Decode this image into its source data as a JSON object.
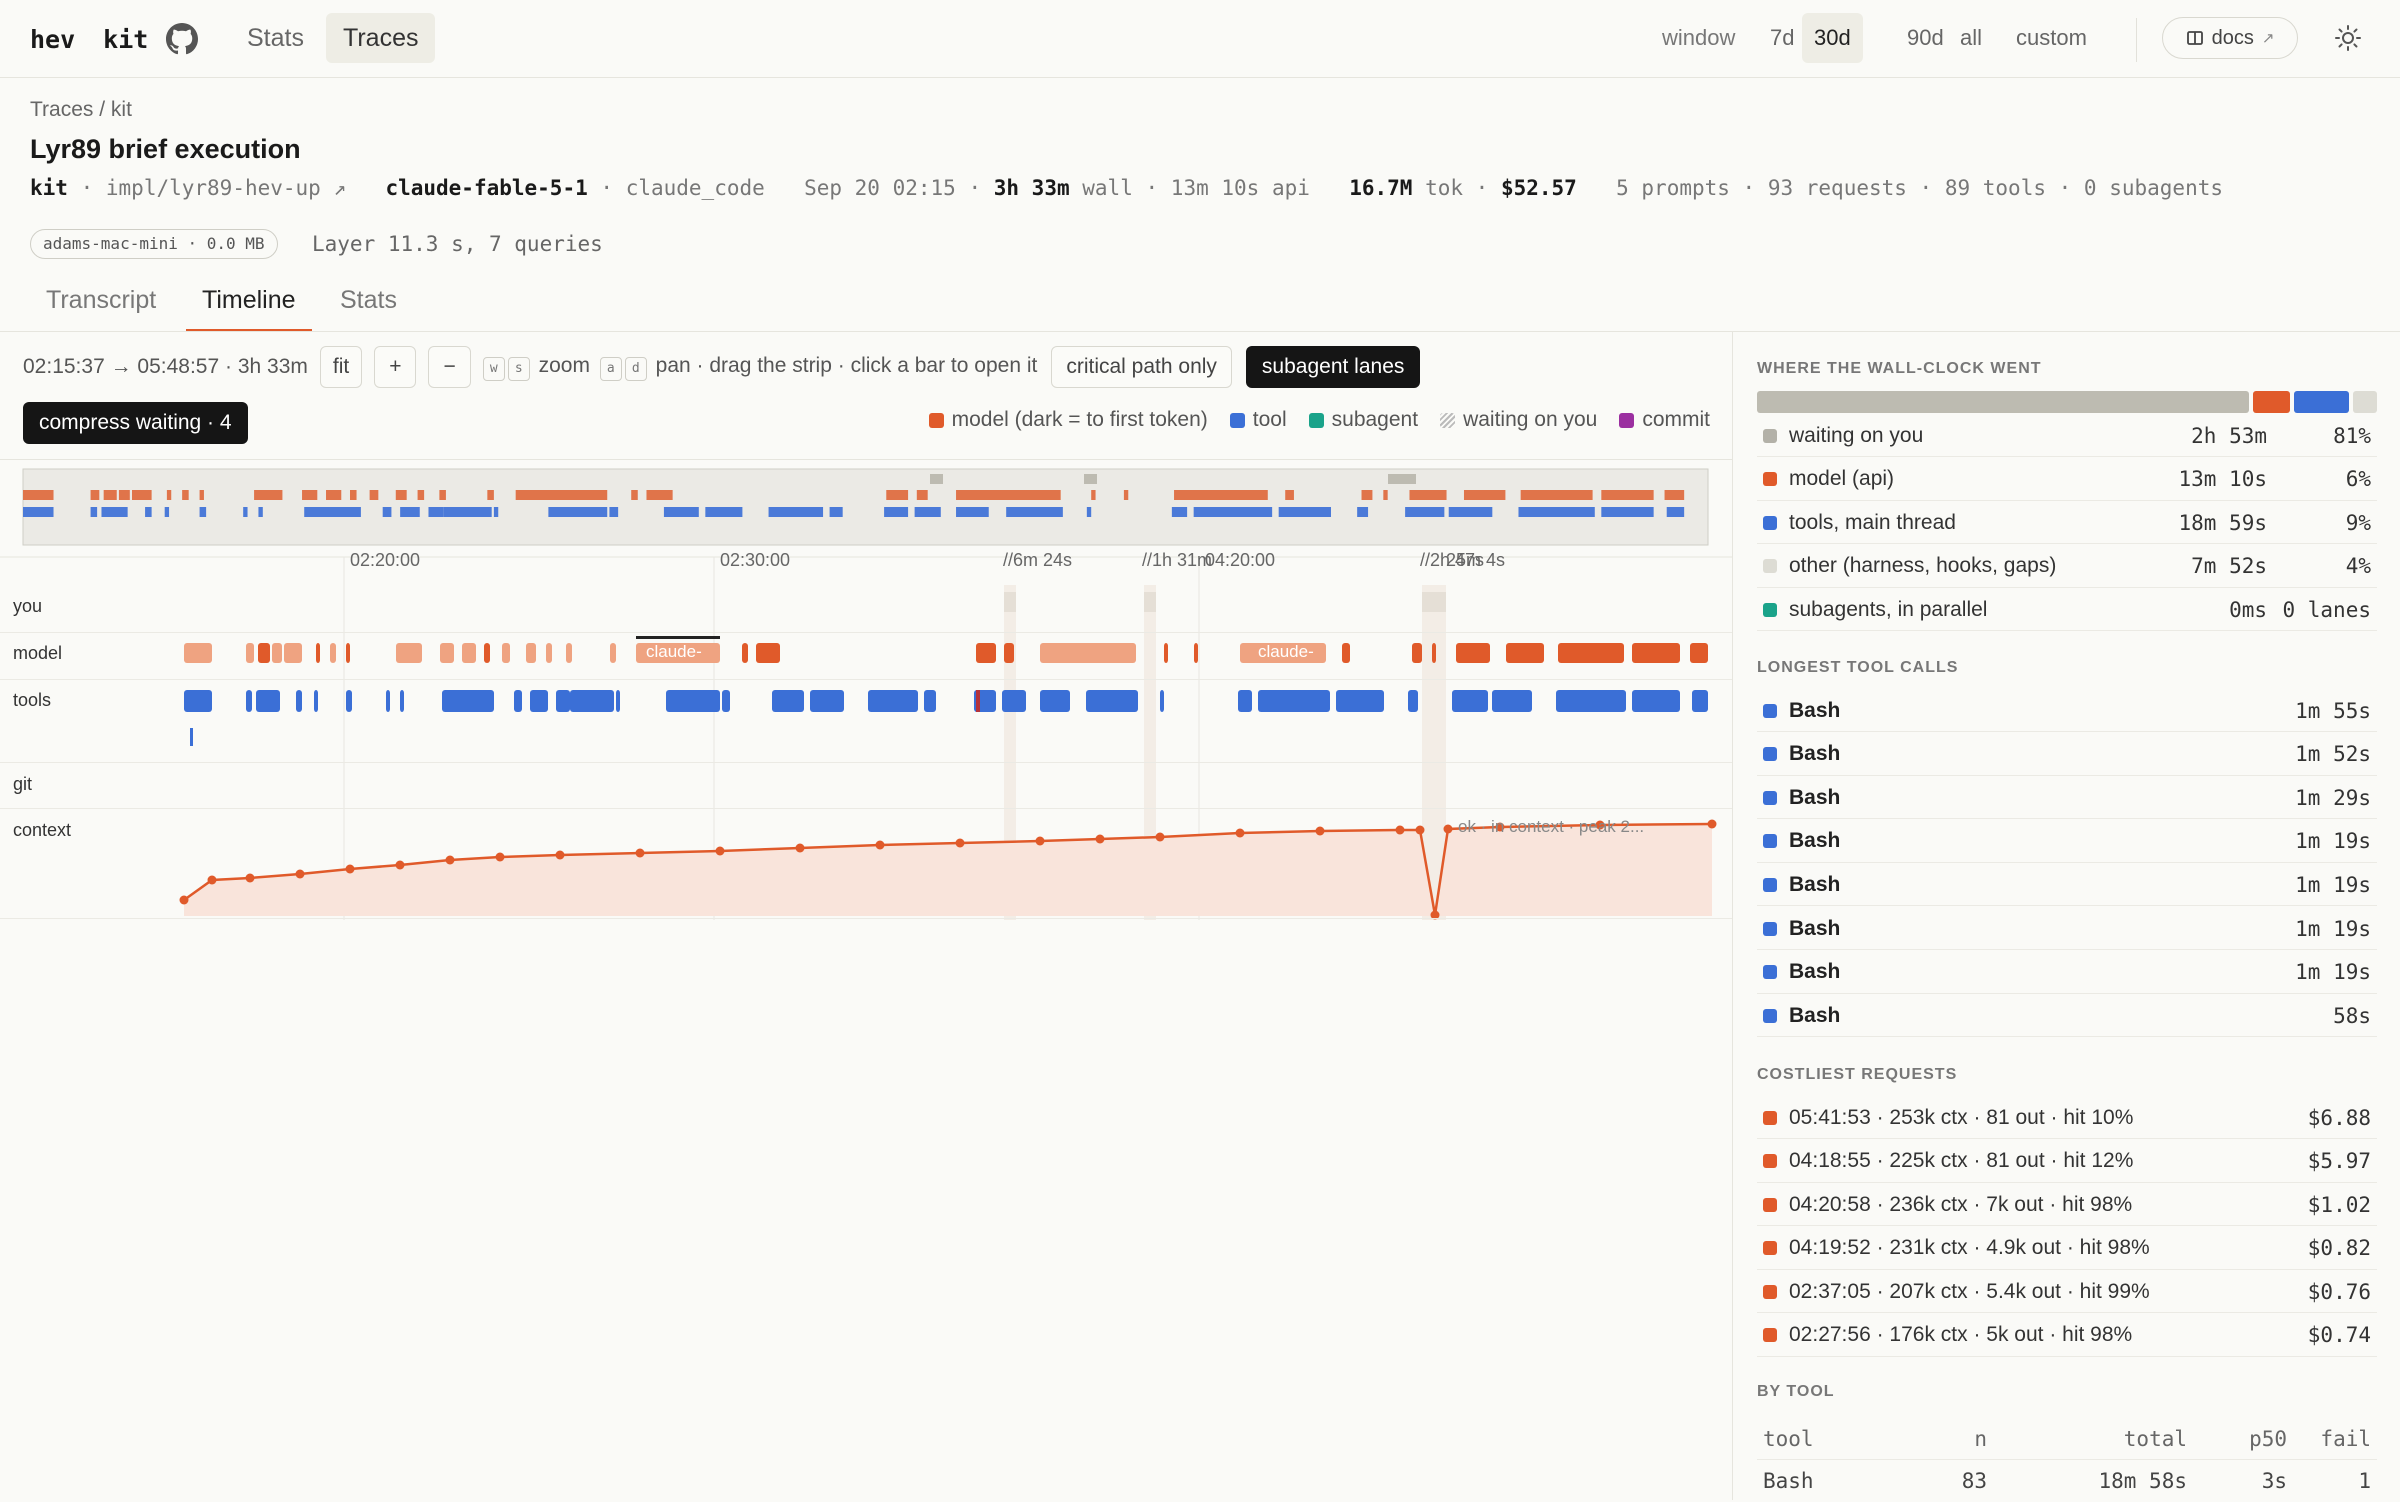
{
  "nav": {
    "brand_a": "hev",
    "brand_b": "kit",
    "links": [
      "Stats",
      "Traces"
    ],
    "active": "Traces"
  },
  "window": {
    "label": "window",
    "options": [
      "7d",
      "30d",
      "90d",
      "all",
      "custom"
    ],
    "active": "30d"
  },
  "docs_label": "docs",
  "breadcrumb": "Traces / kit",
  "title": "Lyr89 brief execution",
  "meta": {
    "project": "kit",
    "branch": "impl/lyr89-hev-up",
    "model": "claude-fable-5-1",
    "agent": "claude_code",
    "date": "Sep 20 02:15",
    "wall": "3h 33m",
    "wall_unit": "wall",
    "api": "13m 10s api",
    "tokens": "16.7M",
    "tokens_unit": "tok",
    "cost": "$52.57",
    "counts": "5 prompts · 93 requests · 89 tools · 0 subagents"
  },
  "host": "adams-mac-mini · 0.0 MB",
  "layer": "Layer 11.3 s, 7 queries",
  "tabs": [
    "Transcript",
    "Timeline",
    "Stats"
  ],
  "active_tab": "Timeline",
  "controls": {
    "range": "02:15:37 → 05:48:57 · 3h 33m",
    "fit": "fit",
    "plus": "+",
    "minus": "−",
    "zoom_keys": [
      "w",
      "s"
    ],
    "zoom_label": "zoom",
    "pan_keys": [
      "a",
      "d"
    ],
    "pan_label": "pan · drag the strip · click a bar to open it",
    "critical": "critical path only",
    "subagent_lanes": "subagent lanes",
    "compress": "compress waiting · 4"
  },
  "legend": [
    {
      "label": "model (dark = to first token)",
      "color": "#e05a2a"
    },
    {
      "label": "tool",
      "color": "#3b6fd6"
    },
    {
      "label": "subagent",
      "color": "#1aa38a"
    },
    {
      "label": "waiting on you",
      "color": "hatch"
    },
    {
      "label": "commit",
      "color": "#9b2fa0"
    }
  ],
  "axis": {
    "ticks": [
      "02:20:00",
      "02:30:00",
      "04:20:00"
    ],
    "gaps": [
      "//6m 24s",
      "//1h 31m",
      "//2h 47s"
    ],
    "gap_overlap": "25m 4s"
  },
  "lanes": [
    "you",
    "model",
    "tools",
    "git",
    "context"
  ],
  "model_bar_labels": [
    "claude-",
    "claude-"
  ],
  "context_label": "ok · in context · peak 2...",
  "right": {
    "wall_title": "WHERE THE WALL-CLOCK WENT",
    "wall_bar": [
      {
        "label": "waiting",
        "pct": 81,
        "color": "#bdbbb1"
      },
      {
        "label": "model",
        "pct": 6,
        "color": "#e05a2a"
      },
      {
        "label": "tools",
        "pct": 9,
        "color": "#3b6fd6"
      },
      {
        "label": "other",
        "pct": 4,
        "color": "#dddcd4"
      }
    ],
    "wall_rows": [
      {
        "label": "waiting on you",
        "v1": "2h 53m",
        "v2": "81%",
        "color": "#b3b1a8"
      },
      {
        "label": "model (api)",
        "v1": "13m 10s",
        "v2": "6%",
        "color": "#e05a2a"
      },
      {
        "label": "tools, main thread",
        "v1": "18m 59s",
        "v2": "9%",
        "color": "#3b6fd6"
      },
      {
        "label": "other (harness, hooks, gaps)",
        "v1": "7m 52s",
        "v2": "4%",
        "color": "#dddcd4"
      },
      {
        "label": "subagents, in parallel",
        "v1": "0ms",
        "v2": "0 lanes",
        "color": "#1aa38a"
      }
    ],
    "tools_title": "LONGEST TOOL CALLS",
    "tools": [
      {
        "name": "Bash",
        "dur": "1m 55s"
      },
      {
        "name": "Bash",
        "dur": "1m 52s"
      },
      {
        "name": "Bash",
        "dur": "1m 29s"
      },
      {
        "name": "Bash",
        "dur": "1m 19s"
      },
      {
        "name": "Bash",
        "dur": "1m 19s"
      },
      {
        "name": "Bash",
        "dur": "1m 19s"
      },
      {
        "name": "Bash",
        "dur": "1m 19s"
      },
      {
        "name": "Bash",
        "dur": "58s"
      }
    ],
    "cost_title": "COSTLIEST REQUESTS",
    "costs": [
      {
        "label": "05:41:53 · 253k ctx · 81 out · hit 10%",
        "cost": "$6.88"
      },
      {
        "label": "04:18:55 · 225k ctx · 81 out · hit 12%",
        "cost": "$5.97"
      },
      {
        "label": "04:20:58 · 236k ctx · 7k out · hit 98%",
        "cost": "$1.02"
      },
      {
        "label": "04:19:52 · 231k ctx · 4.9k out · hit 98%",
        "cost": "$0.82"
      },
      {
        "label": "02:37:05 · 207k ctx · 5.4k out · hit 99%",
        "cost": "$0.76"
      },
      {
        "label": "02:27:56 · 176k ctx · 5k out · hit 98%",
        "cost": "$0.74"
      }
    ],
    "bytool_title": "BY TOOL",
    "bytool_head": [
      "tool",
      "n",
      "total",
      "p50",
      "fail"
    ],
    "bytool_rows": [
      [
        "Bash",
        "83",
        "18m 58s",
        "3s",
        "1"
      ]
    ]
  }
}
